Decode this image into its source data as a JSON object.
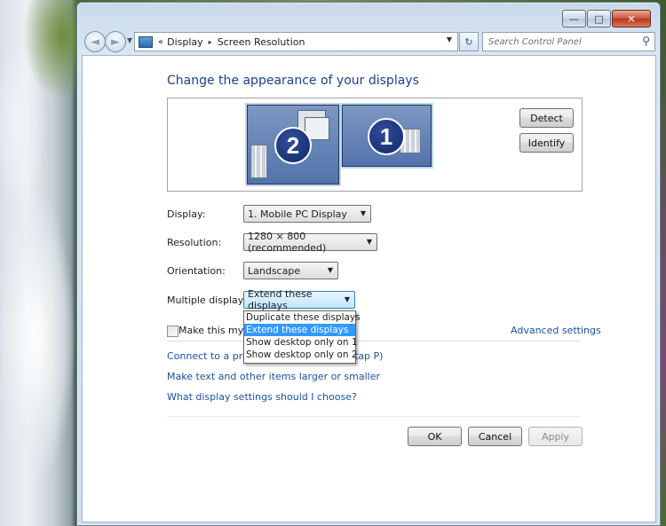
{
  "window": {
    "caption_buttons": {
      "minimize": "—",
      "maximize": "□",
      "close": "✕"
    }
  },
  "navbar": {
    "back_glyph": "◄",
    "forward_glyph": "►",
    "history_glyph": "▼",
    "breadcrumb_prefix": "«",
    "breadcrumb": [
      "Display",
      "Screen Resolution"
    ],
    "breadcrumb_separator": "▸",
    "dropdown_glyph": "▼",
    "refresh_glyph": "↻",
    "search_placeholder": "Search Control Panel",
    "search_glyph": "⚲"
  },
  "page": {
    "heading": "Change the appearance of your displays",
    "monitors": [
      {
        "number": "2",
        "selected": false
      },
      {
        "number": "1",
        "selected": true
      }
    ],
    "detect_label": "Detect",
    "identify_label": "Identify",
    "fields": {
      "display": {
        "label": "Display:",
        "value": "1. Mobile PC Display"
      },
      "resolution": {
        "label": "Resolution:",
        "value": "1280 × 800 (recommended)"
      },
      "orientation": {
        "label": "Orientation:",
        "value": "Landscape"
      },
      "multiple": {
        "label": "Multiple displays:",
        "value": "Extend these displays"
      }
    },
    "combo_arrow": "▼",
    "multiple_options": [
      "Duplicate these displays",
      "Extend these displays",
      "Show desktop only on 1",
      "Show desktop only on 2"
    ],
    "main_display_checkbox_label": "Make this my ma",
    "advanced_settings": "Advanced settings",
    "links": {
      "connect_projector": "Connect to a projec",
      "connect_projector_tail": "tap P)",
      "text_size": "Make text and other items larger or smaller",
      "which_settings": "What display settings should I choose?"
    },
    "ok_label": "OK",
    "cancel_label": "Cancel",
    "apply_label": "Apply"
  },
  "colors": {
    "heading": "#1e3f8f",
    "link": "#1c4fa6",
    "selected_option": "#3399ff"
  }
}
